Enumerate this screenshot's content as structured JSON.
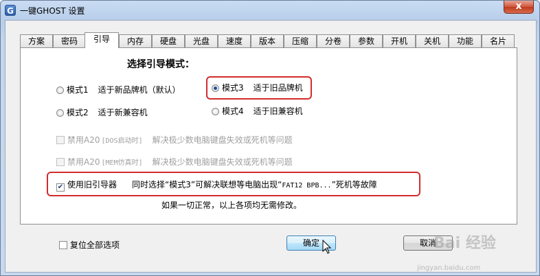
{
  "window": {
    "title": "一键GHOST 设置",
    "icon_letter": "G",
    "close_label": "x"
  },
  "tabs": [
    "方案",
    "密码",
    "引导",
    "内存",
    "硬盘",
    "光盘",
    "速度",
    "版本",
    "压缩",
    "分卷",
    "参数",
    "开机",
    "关机",
    "功能",
    "名片"
  ],
  "active_tab": "引导",
  "boot": {
    "heading": "选择引导模式：",
    "mode1": {
      "label": "模式1",
      "desc": "适于新品牌机（默认）",
      "selected": false
    },
    "mode2": {
      "label": "模式2",
      "desc": "适于新兼容机",
      "selected": false
    },
    "mode3": {
      "label": "模式3",
      "desc": "适于旧品牌机",
      "selected": true
    },
    "mode4": {
      "label": "模式4",
      "desc": "适于旧兼容机",
      "selected": false
    },
    "a20_dos": {
      "label_prefix": "禁用A20",
      "label_mono": "[DOS启动时]",
      "desc": "解决极少数电脑键盘失效或死机等问题",
      "checked": false
    },
    "a20_mem": {
      "label_prefix": "禁用A20",
      "label_mono": "[MEM仿真时]",
      "desc": "解决极少数电脑键盘失效或死机等问题",
      "checked": false
    },
    "old_loader": {
      "label": "使用旧引导器",
      "desc_prefix": "同时选择“模式3”可解决联想等电脑出现“",
      "desc_mono": "FAT12 BPB...",
      "desc_suffix": "”死机等故障",
      "checked": true
    },
    "note": "如果一切正常，以上各项均无需修改。"
  },
  "footer": {
    "reset_label": "复位全部选项",
    "ok_label": "确定",
    "cancel_label": "取消"
  },
  "watermark": {
    "text": "Bai 经验",
    "url": "jingyan.baidu.com"
  },
  "colors": {
    "highlight": "#d22c2c",
    "accent": "#1f4f9c"
  }
}
